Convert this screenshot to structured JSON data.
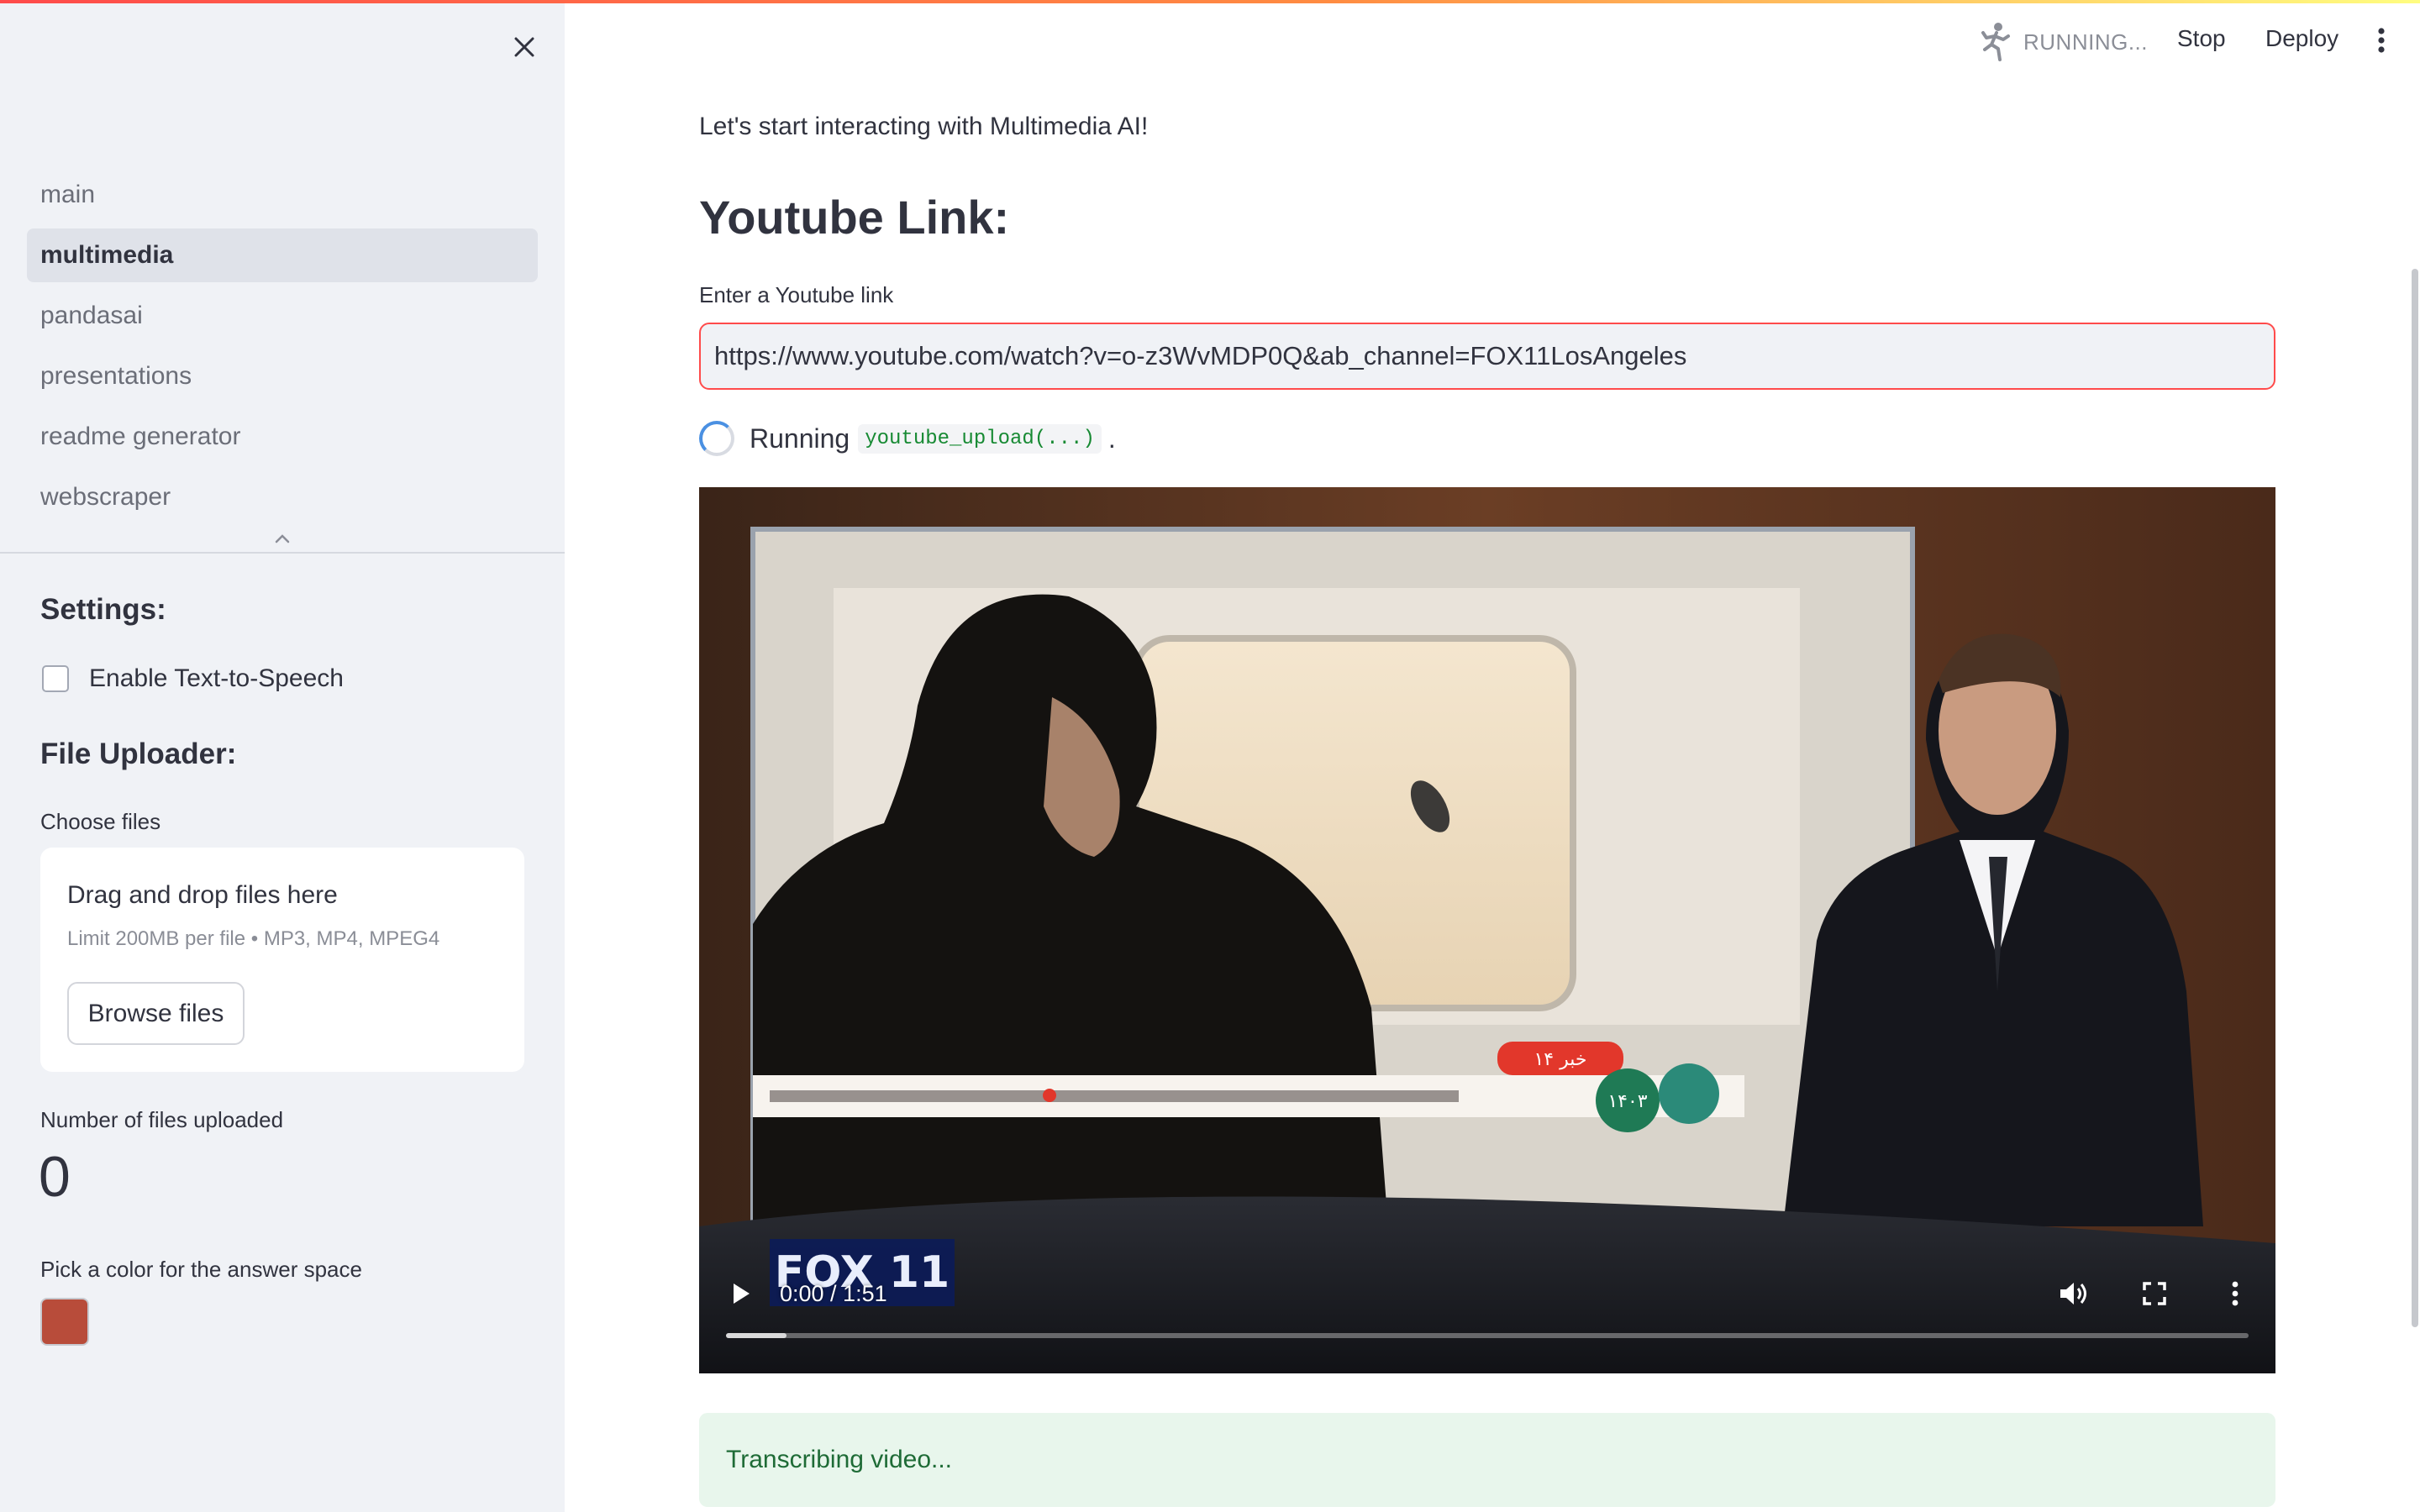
{
  "header": {
    "status_text": "RUNNING...",
    "stop_label": "Stop",
    "deploy_label": "Deploy"
  },
  "sidebar": {
    "nav_items": [
      {
        "label": "main"
      },
      {
        "label": "multimedia",
        "active": true
      },
      {
        "label": "pandasai"
      },
      {
        "label": "presentations"
      },
      {
        "label": "readme generator"
      },
      {
        "label": "webscraper"
      }
    ],
    "settings_heading": "Settings:",
    "tts_label": "Enable Text-to-Speech",
    "tts_checked": false,
    "uploader_heading": "File Uploader:",
    "choose_files_label": "Choose files",
    "drop_title": "Drag and drop files here",
    "drop_limit": "Limit 200MB per file • MP3, MP4, MPEG4",
    "browse_label": "Browse files",
    "files_count_label": "Number of files uploaded",
    "files_count": "0",
    "color_label": "Pick a color for the answer space",
    "answer_color": "#b84c3a"
  },
  "main": {
    "intro": "Let's start interacting with Multimedia AI!",
    "heading": "Youtube Link:",
    "input_label": "Enter a Youtube link",
    "input_value": "https://www.youtube.com/watch?v=o-z3WvMDP0Q&ab_channel=FOX11LosAngeles",
    "status_word": "Running",
    "status_code": "youtube_upload(...)",
    "status_suffix": ".",
    "video": {
      "time": "0:00 / 1:51",
      "buffered_fraction": 0.04,
      "brand": "FOX 11",
      "ticker_label": "۱۴ خبر",
      "ticker_date": "۱۴۰۳"
    },
    "info_text": "Transcribing video..."
  },
  "colors": {
    "accent": "#ff4b4b",
    "sidebar_bg": "#f0f2f6",
    "success_bg": "#e8f6ec",
    "success_text": "#1e6b36"
  }
}
